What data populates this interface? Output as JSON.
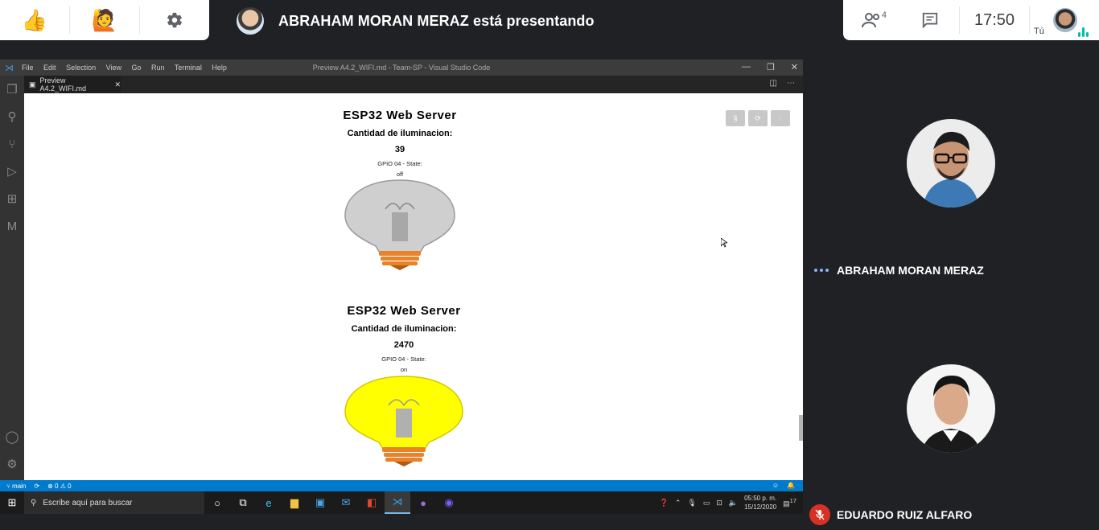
{
  "meet": {
    "presenter_text": "ABRAHAM MORAN MERAZ está presentando",
    "participants_count": "4",
    "clock": "17:50",
    "you_label": "Tú",
    "participants": [
      {
        "name": "ABRAHAM MORAN MERAZ",
        "status": "speaking"
      },
      {
        "name": "EDUARDO RUIZ ALFARO",
        "status": "muted"
      }
    ]
  },
  "vscode": {
    "menu": [
      "File",
      "Edit",
      "Selection",
      "View",
      "Go",
      "Run",
      "Terminal",
      "Help"
    ],
    "window_title": "Preview A4.2_WIFI.md - Team-SP - Visual Studio Code",
    "tab_label": "Preview A4.2_WIFI.md",
    "status_branch": "main",
    "status_problems": "0",
    "status_warnings": "0",
    "preview": {
      "blocks": [
        {
          "title": "ESP32 Web Server",
          "subtitle": "Cantidad de iluminacion:",
          "value": "39",
          "gpio": "GPIO 04 - State:",
          "state": "off",
          "bulb_color": "#cfcfcf"
        },
        {
          "title": "ESP32 Web Server",
          "subtitle": "Cantidad de iluminacion:",
          "value": "2470",
          "gpio": "GPIO 04 - State:",
          "state": "on",
          "bulb_color": "#ffff00"
        }
      ],
      "toolbar_buttons": [
        "§",
        "⟳",
        "⫶"
      ]
    }
  },
  "taskbar": {
    "search_placeholder": "Escribe aquí para buscar",
    "time": "05:50 p. m.",
    "date": "15/12/2020",
    "notifications": "17"
  }
}
